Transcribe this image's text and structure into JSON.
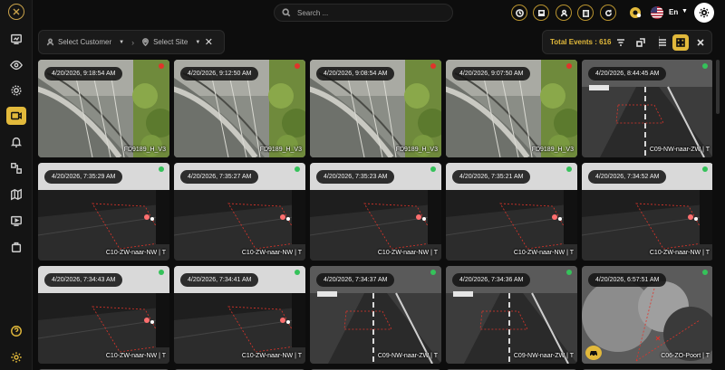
{
  "search": {
    "placeholder": "Search ..."
  },
  "language": "En",
  "filters": {
    "customer": "Select Customer",
    "site": "Select Site"
  },
  "total_events": "Total Events : 616",
  "colors": {
    "accent": "#e2b93b",
    "status_red": "#e0342a",
    "status_green": "#35c25a"
  },
  "sidebar_icons": [
    "dashboard-icon",
    "eye-icon",
    "settings-icon",
    "camera-icon",
    "bell-icon",
    "nodes-icon",
    "map-icon",
    "play-icon",
    "bag-icon",
    "help-icon",
    "gear-icon"
  ],
  "events": [
    {
      "time": "4/20/2026, 9:18:54 AM",
      "camera": "FD9189_H_V3",
      "status": "red",
      "scene": "fence"
    },
    {
      "time": "4/20/2026, 9:12:50 AM",
      "camera": "FD9189_H_V3",
      "status": "red",
      "scene": "fence"
    },
    {
      "time": "4/20/2026, 9:08:54 AM",
      "camera": "FD9189_H_V3",
      "status": "red",
      "scene": "fence"
    },
    {
      "time": "4/20/2026, 9:07:50 AM",
      "camera": "FD9189_H_V3",
      "status": "red",
      "scene": "fence"
    },
    {
      "time": "4/20/2026, 8:44:45 AM",
      "camera": "C09-NW-naar-ZW | T",
      "status": "green",
      "scene": "road"
    },
    {
      "time": "4/20/2026, 7:35:29 AM",
      "camera": "C10-ZW-naar-NW | T",
      "status": "green",
      "scene": "night"
    },
    {
      "time": "4/20/2026, 7:35:27 AM",
      "camera": "C10-ZW-naar-NW | T",
      "status": "green",
      "scene": "night"
    },
    {
      "time": "4/20/2026, 7:35:23 AM",
      "camera": "C10-ZW-naar-NW | T",
      "status": "green",
      "scene": "night"
    },
    {
      "time": "4/20/2026, 7:35:21 AM",
      "camera": "C10-ZW-naar-NW | T",
      "status": "green",
      "scene": "night"
    },
    {
      "time": "4/20/2026, 7:34:52 AM",
      "camera": "C10-ZW-naar-NW | T",
      "status": "green",
      "scene": "night"
    },
    {
      "time": "4/20/2026, 7:34:43 AM",
      "camera": "C10-ZW-naar-NW | T",
      "status": "green",
      "scene": "night"
    },
    {
      "time": "4/20/2026, 7:34:41 AM",
      "camera": "C10-ZW-naar-NW | T",
      "status": "green",
      "scene": "night"
    },
    {
      "time": "4/20/2026, 7:34:37 AM",
      "camera": "C09-NW-naar-ZW | T",
      "status": "green",
      "scene": "road"
    },
    {
      "time": "4/20/2026, 7:34:36 AM",
      "camera": "C09-NW-naar-ZW | T",
      "status": "green",
      "scene": "road"
    },
    {
      "time": "4/20/2026, 6:57:51 AM",
      "camera": "C06-ZO-Poort | T",
      "status": "green",
      "scene": "thermal",
      "vehicle_badge": true
    }
  ]
}
